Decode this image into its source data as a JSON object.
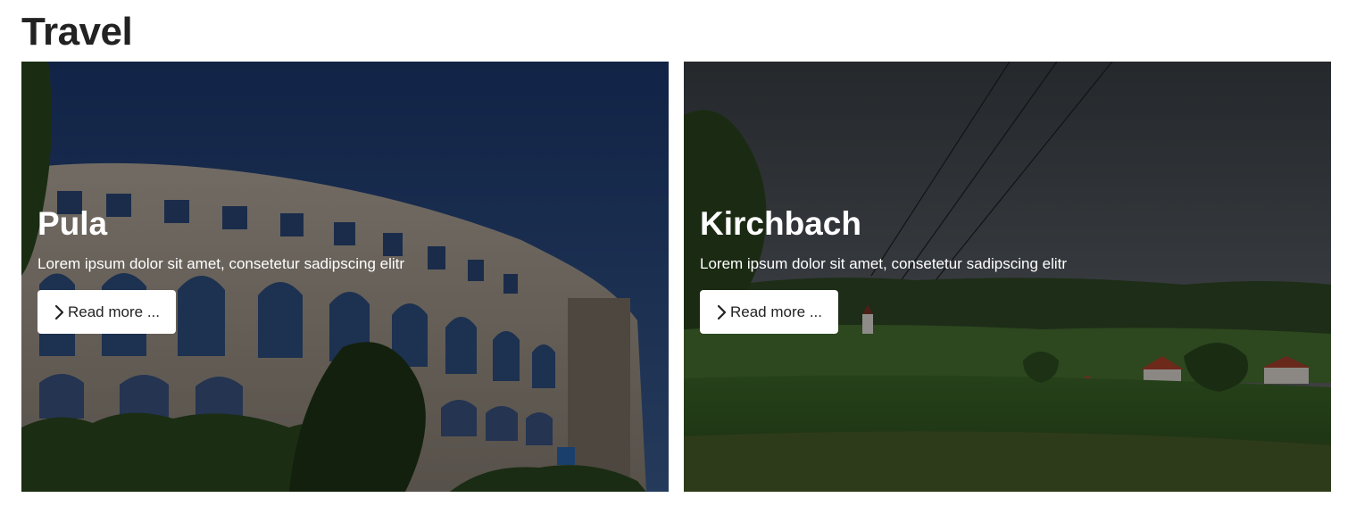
{
  "section": {
    "title": "Travel"
  },
  "cards": [
    {
      "title": "Pula",
      "text": "Lorem ipsum dolor sit amet, consetetur sadipscing elitr",
      "button_label": "Read more ...",
      "button_icon": "chevron-right-icon"
    },
    {
      "title": "Kirchbach",
      "text": "Lorem ipsum dolor sit amet, consetetur sadipscing elitr",
      "button_label": "Read more ...",
      "button_icon": "chevron-right-icon"
    }
  ],
  "colors": {
    "title_text": "#222222",
    "card_text": "#ffffff",
    "button_bg": "#ffffff"
  }
}
